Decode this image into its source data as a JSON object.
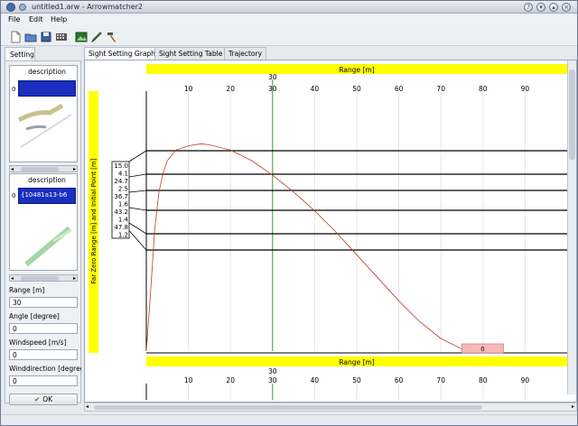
{
  "window": {
    "title": "untitled1.arw - Arrowmatcher2",
    "buttons": [
      "?",
      "▾",
      "▴",
      "×"
    ]
  },
  "menu": [
    "File",
    "Edit",
    "Help"
  ],
  "toolbar": {
    "icons": [
      "new-file-icon",
      "open-file-icon",
      "save-icon",
      "calculator-icon",
      "image-icon",
      "pencil-icon",
      "hammer-icon"
    ]
  },
  "left_panel": {
    "tab_label": "Setting",
    "list1": {
      "header": "description",
      "row_number": "0",
      "value": ""
    },
    "list2": {
      "header": "description",
      "row_number": "0",
      "value": "{10481a13-b6"
    },
    "fields": [
      {
        "label": "Range [m]",
        "value": "30"
      },
      {
        "label": "Angle [degree]",
        "value": "0"
      },
      {
        "label": "Windspeed [m/s]",
        "value": "0"
      },
      {
        "label": "Winddirection [degree]",
        "value": "0"
      }
    ],
    "ok_label": "OK"
  },
  "tabs": [
    {
      "label": "Sight Setting Graph",
      "active": true
    },
    {
      "label": "Sight Setting Table",
      "active": false
    },
    {
      "label": "Trajectory",
      "active": false
    }
  ],
  "chart_data": {
    "type": "line",
    "xlabel": "Range [m]",
    "ylabel": "Far Zero Range [m] and Initial Point [m]",
    "x_ticks": [
      10,
      20,
      30,
      40,
      50,
      60,
      70,
      80,
      90
    ],
    "xlim": [
      0,
      100
    ],
    "marker_label": "30",
    "sight_marks": [
      "15.0",
      "4.1",
      "24.7",
      "2.5",
      "36.7",
      "1.6",
      "43.2",
      "1.4",
      "47.8",
      "1.2"
    ],
    "series": [
      {
        "x": [
          0,
          1,
          2,
          3,
          4,
          5,
          7,
          10,
          13,
          15,
          20,
          25,
          30,
          35,
          40,
          45,
          50,
          55,
          60,
          65,
          70,
          75,
          78
        ],
        "y": [
          0,
          28,
          58,
          76,
          85,
          91,
          96,
          98,
          99,
          98.5,
          96,
          91,
          84,
          76,
          67,
          57,
          46,
          35,
          24,
          14,
          6,
          1,
          0
        ]
      }
    ],
    "endpoint_box_label": "0",
    "grid": true,
    "accent_color": "#ffff00"
  }
}
